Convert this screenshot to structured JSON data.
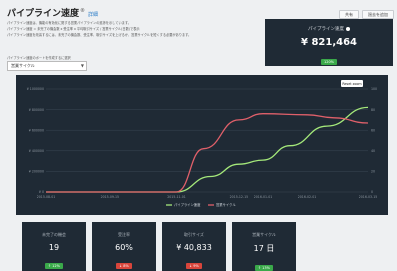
{
  "header": {
    "title": "パイプライン速度",
    "info_glyph": "®",
    "link": "詳細",
    "share_label": "共有",
    "filter_label": "過去を追加"
  },
  "description": [
    "パイプライン速度は、機能の有効化に関する営業パイプラインの進捗を示しています。",
    "パイプライン速度 = 未完了の機会数 x 受注率 x 平均取引サイズ / 営業サイクル(日数)で表示",
    "パイプライン速度を改善するには、未完了の機会数、受注率、取引サイズを上げるか、営業サイクルを短くする必要があります。"
  ],
  "selector": {
    "label": "パイプライン速度のポートを作成するに選択",
    "value": "営業サイクル",
    "arrow": "▼"
  },
  "summary": {
    "label": "パイプライン速度",
    "value": "¥ 821,464",
    "badge": "120%"
  },
  "chart_data": {
    "type": "line",
    "reset_label": "Reset zoom",
    "x": [
      "2015-08-01",
      "2015-09-15",
      "2015-11-01",
      "2015-12-15",
      "2016-01-01",
      "2016-02-01",
      "2016-03-15"
    ],
    "x_tick_labels": [
      "2015-08-01",
      "2015-09-15",
      "2015-11-01",
      "2015-12-15",
      "2016-01-01",
      "2016-02-01",
      "2016-03-15"
    ],
    "y_left_ticks": [
      "¥ 1000000",
      "¥ 800000",
      "¥ 600000",
      "¥ 400000",
      "¥ 200000",
      "¥ 0"
    ],
    "y_right_ticks": [
      "100",
      "80",
      "60",
      "40",
      "20",
      "0"
    ],
    "y_left_range": [
      0,
      1000000
    ],
    "y_right_range": [
      0,
      100
    ],
    "series": [
      {
        "name": "パイプライン速度",
        "axis": "left",
        "color": "#a4e87a",
        "points": [
          [
            "2015-08-01",
            0
          ],
          [
            "2015-09-15",
            0
          ],
          [
            "2015-11-01",
            0
          ],
          [
            "2015-11-25",
            150000
          ],
          [
            "2015-12-15",
            270000
          ],
          [
            "2016-01-01",
            310000
          ],
          [
            "2016-01-20",
            450000
          ],
          [
            "2016-02-15",
            640000
          ],
          [
            "2016-03-15",
            821464
          ]
        ]
      },
      {
        "name": "営業サイクル",
        "axis": "right",
        "color": "#e0606a",
        "points": [
          [
            "2015-08-01",
            0
          ],
          [
            "2015-09-15",
            0
          ],
          [
            "2015-11-01",
            0
          ],
          [
            "2015-11-20",
            42
          ],
          [
            "2015-12-15",
            70
          ],
          [
            "2016-01-01",
            76
          ],
          [
            "2016-02-01",
            75
          ],
          [
            "2016-02-20",
            72
          ],
          [
            "2016-03-15",
            67
          ]
        ]
      }
    ],
    "legend_position": "bottom-center",
    "grid": true
  },
  "kpis": [
    {
      "label": "未完了の機会",
      "value": "19",
      "badge": "↑ 12%",
      "status": "up"
    },
    {
      "label": "受注率",
      "value": "60%",
      "badge": "↓ 8%",
      "status": "down"
    },
    {
      "label": "取引サイズ",
      "value": "¥ 40,833",
      "badge": "↓ 9%",
      "status": "down"
    },
    {
      "label": "営業サイクル",
      "value": "17 日",
      "badge": "↑ 13%",
      "status": "up"
    }
  ]
}
